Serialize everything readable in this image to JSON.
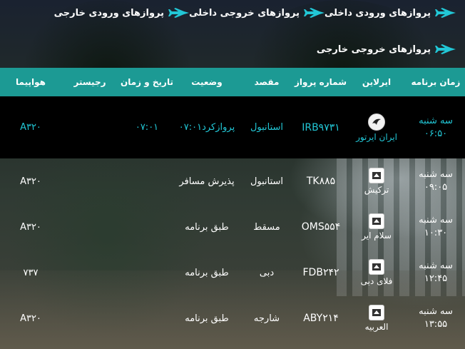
{
  "nav": {
    "items": [
      {
        "label": "پروازهای ورودی داخلی"
      },
      {
        "label": "پروازهای خروجی داخلی"
      },
      {
        "label": "پروازهای ورودی خارجی"
      },
      {
        "label": "پروازهای خروجی خارجی"
      }
    ]
  },
  "table": {
    "headers": [
      "زمان برنامه",
      "ایرلاین",
      "شماره پرواز",
      "مقصد",
      "وضعیت",
      "تاریخ و زمان",
      "رجیستر",
      "هواپیما"
    ],
    "rows": [
      {
        "day": "سه شنبه",
        "time": "۰۶:۵۰",
        "airline": "ایران ایرتور",
        "flight": "IRB۹۷۳۱",
        "dest": "استانبول",
        "status": "پروازکرد۰۷:۰۱",
        "datetime": "۰۷:۰۱",
        "register": "",
        "aircraft": "A۳۲۰"
      },
      {
        "day": "سه شنبه",
        "time": "۰۹:۰۵",
        "airline": "ترکیش",
        "flight": "TK۸۸۵",
        "dest": "استانبول",
        "status": "پذیرش مسافر",
        "datetime": "",
        "register": "",
        "aircraft": "A۳۲۰"
      },
      {
        "day": "سه شنبه",
        "time": "۱۰:۳۰",
        "airline": "سلام ایر",
        "flight": "OMS۵۵۴",
        "dest": "مسقط",
        "status": "طبق برنامه",
        "datetime": "",
        "register": "",
        "aircraft": "A۳۲۰"
      },
      {
        "day": "سه شنبه",
        "time": "۱۲:۴۵",
        "airline": "فلای دبی",
        "flight": "FDB۲۴۲",
        "dest": "دبی",
        "status": "طبق برنامه",
        "datetime": "",
        "register": "",
        "aircraft": "۷۳۷"
      },
      {
        "day": "سه شنبه",
        "time": "۱۳:۵۵",
        "airline": "العربیه",
        "flight": "ABY۲۱۴",
        "dest": "شارجه",
        "status": "طبق برنامه",
        "datetime": "",
        "register": "",
        "aircraft": "A۳۲۰"
      }
    ]
  },
  "colors": {
    "header_bg": "#1c9a94",
    "accent": "#22c7d6",
    "highlight_row_bg": "#000000"
  },
  "icons": [
    "plane-icon",
    "airline-logo-icon"
  ]
}
